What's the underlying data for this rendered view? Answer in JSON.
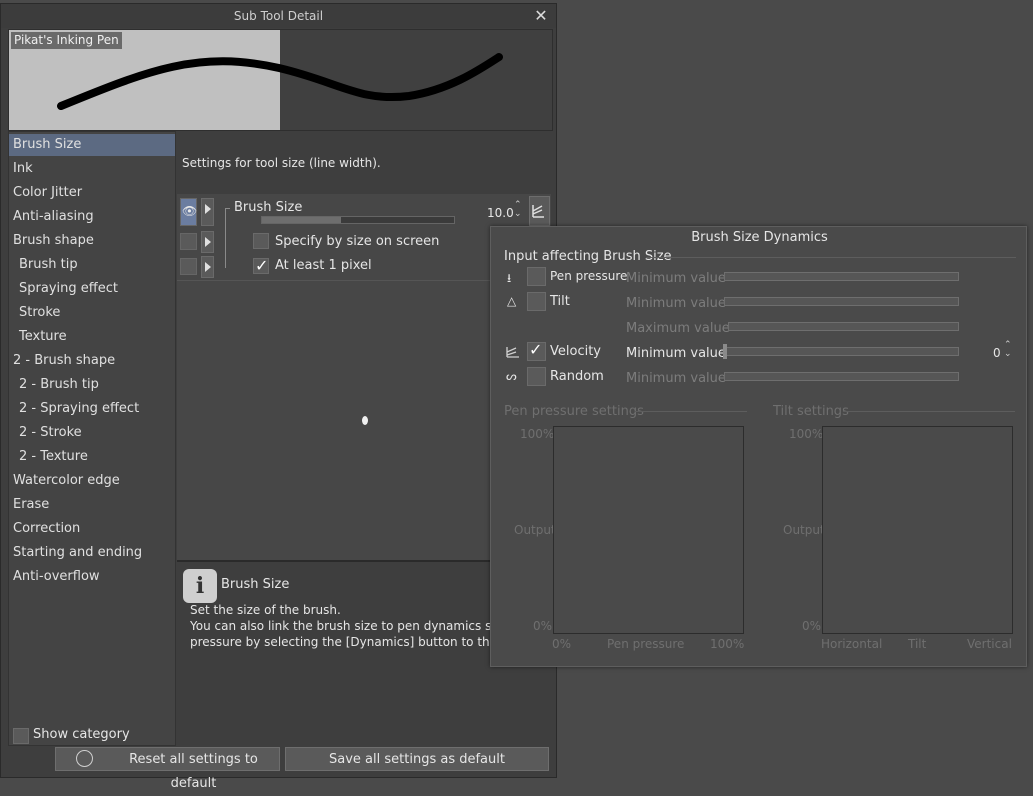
{
  "window": {
    "title": "Sub Tool Detail",
    "close": "✕"
  },
  "preview": {
    "name": "Pikat's Inking Pen"
  },
  "categories": [
    {
      "label": "Brush Size",
      "selected": true,
      "sub": false
    },
    {
      "label": "Ink",
      "sub": false
    },
    {
      "label": "Color Jitter",
      "sub": false
    },
    {
      "label": "Anti-aliasing",
      "sub": false
    },
    {
      "label": "Brush shape",
      "sub": false
    },
    {
      "label": "Brush tip",
      "sub": true
    },
    {
      "label": "Spraying effect",
      "sub": true
    },
    {
      "label": "Stroke",
      "sub": true
    },
    {
      "label": "Texture",
      "sub": true
    },
    {
      "label": "2 - Brush shape",
      "sub": false
    },
    {
      "label": "2 - Brush tip",
      "sub": true
    },
    {
      "label": "2 - Spraying effect",
      "sub": true
    },
    {
      "label": "2 - Stroke",
      "sub": true
    },
    {
      "label": "2 - Texture",
      "sub": true
    },
    {
      "label": "Watercolor edge",
      "sub": false
    },
    {
      "label": "Erase",
      "sub": false
    },
    {
      "label": "Correction",
      "sub": false
    },
    {
      "label": "Starting and ending",
      "sub": false
    },
    {
      "label": "Anti-overflow",
      "sub": false
    }
  ],
  "show_category": "Show category",
  "settings": {
    "description": "Settings for tool size (line width).",
    "brush_size_label": "Brush Size",
    "brush_size_value": "10.0",
    "brush_size_fraction": 0.41,
    "specify_label": "Specify by size on screen",
    "at_least_label": "At least 1 pixel"
  },
  "help": {
    "title": "Brush Size",
    "line1": "Set the size of the brush.",
    "line2": "You can also link the brush size to pen dynamics su",
    "line3": "pressure by selecting the [Dynamics] button to the r"
  },
  "buttons": {
    "reset": "Reset all settings to default",
    "save": "Save all settings as default"
  },
  "dynamics": {
    "title": "Brush Size Dynamics",
    "section": "Input affecting Brush Size",
    "rows": {
      "pen": "Pen pressure",
      "tilt": "Tilt",
      "velocity": "Velocity",
      "random": "Random"
    },
    "min_label": "Minimum value",
    "max_label": "Maximum value",
    "velocity_value": "0",
    "pen_settings": "Pen pressure settings",
    "tilt_settings": "Tilt settings",
    "y_top": "100%",
    "y_mid": "Output",
    "y_bot": "0%",
    "pen_x_left": "0%",
    "pen_x_mid": "Pen pressure",
    "pen_x_right": "100%",
    "tilt_x_left": "Horizontal",
    "tilt_x_mid": "Tilt",
    "tilt_x_right": "Vertical"
  }
}
